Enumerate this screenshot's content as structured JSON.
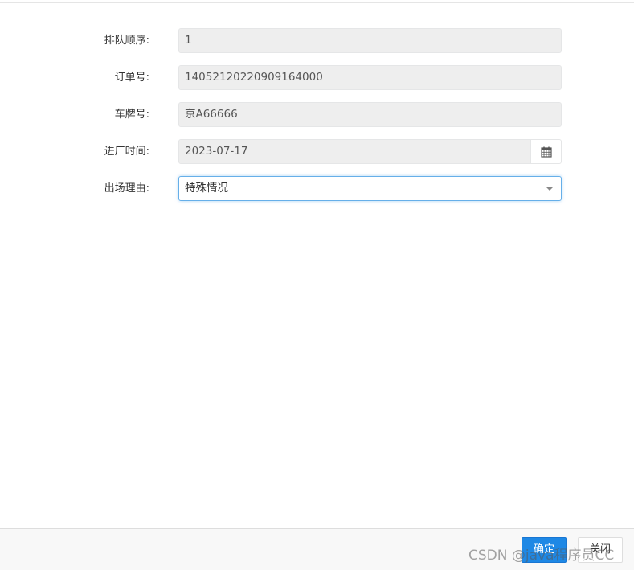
{
  "form": {
    "queue_order": {
      "label": "排队顺序:",
      "value": "1"
    },
    "order_no": {
      "label": "订单号:",
      "value": "14052120220909164000"
    },
    "plate_no": {
      "label": "车牌号:",
      "value": "京A66666"
    },
    "entry_time": {
      "label": "进厂时间:",
      "value": "2023-07-17"
    },
    "exit_reason": {
      "label": "出场理由:",
      "selected": "特殊情况"
    }
  },
  "footer": {
    "confirm_label": "确定",
    "close_label": "关闭"
  },
  "watermark": "CSDN @java程序员CC",
  "icons": {
    "date_addon": "calendar-icon",
    "select_arrow": "caret-down-icon"
  },
  "colors": {
    "primary": "#1e88e5",
    "readonly_bg": "#eeeeee",
    "focus_border": "#66afe9"
  }
}
